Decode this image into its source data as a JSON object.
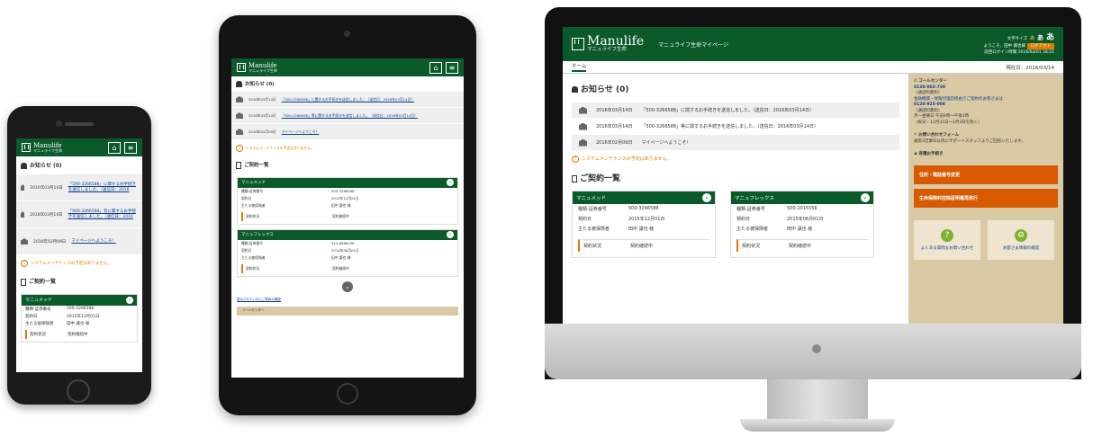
{
  "brand": {
    "name": "Manulife",
    "sub": "マニュライフ生命",
    "app_title": "マニュライフ生命マイページ",
    "green": "#0b5a2a",
    "orange": "#e07b00"
  },
  "header": {
    "font_size_label": "文字サイズ",
    "font_small": "あ",
    "font_mid": "あ",
    "font_large": "あ",
    "welcome": "ようこそ、田中 譲也様",
    "logout": "ログアウト",
    "last_login": "前回ログイン時間 2016/03/01 18:21"
  },
  "subnav": {
    "home": "ホーム",
    "date": "現在日：2016/03/14"
  },
  "news": {
    "title": "お知らせ (0)",
    "items": [
      {
        "date": "2016年03月14日",
        "text": "「500-3266588」に関するお手続きを送信しました。（送信日：2016年03月14日）",
        "phone_text": "「500-3266588」に関するお手続きを送信しました。（送信日：2016"
      },
      {
        "date": "2016年03月14日",
        "text": "「500-3266588」等に関するお手続きを送信しました。（送信日：2016年03月14日）",
        "phone_text": "「500-3266588」等に関するお手続きを送信しました。（送信日：2016"
      },
      {
        "date": "2016年02月09日",
        "text": "マイページへようこそ！",
        "phone_text": "マイページへようこそ！"
      }
    ],
    "system": "システムメンテナンスの予定はありません。"
  },
  "contracts": {
    "title": "ご契約一覧",
    "labels": {
      "number": "種類-証券番号",
      "date": "契約日",
      "insured": "主たる被保険者",
      "status": "契約状況"
    },
    "items": [
      {
        "name": "マニュメッド",
        "number": "500-3266588",
        "date": "2015年12月01日",
        "insured": "田中 譲也 様",
        "status": "契約継続中"
      },
      {
        "name": "マニュフレックス",
        "number": "500-2015556",
        "date": "2015年06月01日",
        "insured": "田中 譲也 様",
        "status": "契約継続中"
      }
    ],
    "tablet_second_number": "514-6968156",
    "tablet_second_date": "2014年06月01日",
    "tablet_footer_link": "表示されていないご契約の確認",
    "tablet_tan_text": "コールセンター"
  },
  "sidebar": {
    "call_center_title": "コールセンター",
    "call_number": "0120-063-730",
    "call_note": "（通話料無料）",
    "bank_title": "金融機関・保険代理店経由でご契約のお客さまは",
    "bank_title2": "受付時間：月～金曜日",
    "bank_number": "0120-925-008",
    "bank_note": "（通話料無料）",
    "hours": "月～金曜日 午前9時～午後5時",
    "hours_note": "（祝日・12月31日～1月3日を除く）",
    "form_title": "お問い合わせフォーム",
    "form_text": "通常3営業日以内にサポートスタッフよりご回答いたします。",
    "procedure_title": "各種お手続き",
    "btn_address": "住所・電話番号変更",
    "btn_certificate": "生命保険料控除証明書再発行",
    "tile_faq": "よくある質問＆お問い合わせ",
    "tile_settings": "お客さま情報の確認"
  }
}
